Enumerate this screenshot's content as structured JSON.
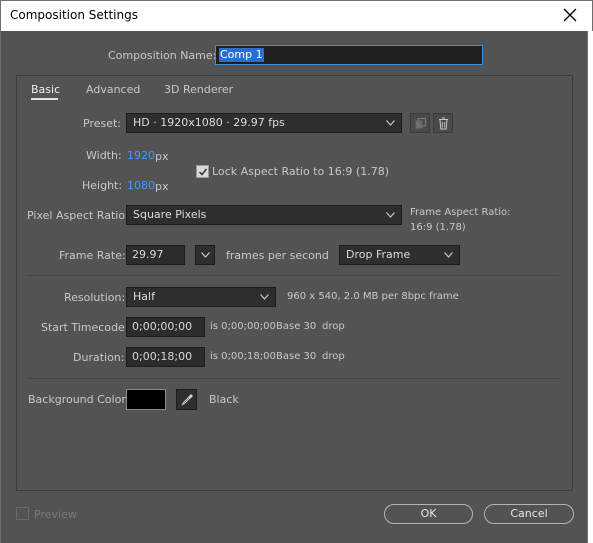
{
  "window": {
    "title": "Composition Settings"
  },
  "comp_name": {
    "label": "Composition Name:",
    "value": "Comp 1"
  },
  "tabs": [
    {
      "label": "Basic"
    },
    {
      "label": "Advanced"
    },
    {
      "label": "3D Renderer"
    }
  ],
  "preset": {
    "label": "Preset:",
    "value": "HD  ·  1920x1080 · 29.97 fps"
  },
  "width": {
    "label": "Width:",
    "value": "1920",
    "unit": "px"
  },
  "height": {
    "label": "Height:",
    "value": "1080",
    "unit": "px"
  },
  "lock_aspect": {
    "label": "Lock Aspect Ratio to 16:9 (1.78)",
    "checked": true
  },
  "pixel_aspect": {
    "label": "Pixel Aspect Ratio:",
    "value": "Square Pixels",
    "frame_aspect_label": "Frame Aspect Ratio:",
    "frame_aspect_value": "16:9 (1.78)"
  },
  "frame_rate": {
    "label": "Frame Rate:",
    "value": "29.97",
    "unit_label": "frames per second",
    "drop_value": "Drop Frame"
  },
  "resolution": {
    "label": "Resolution:",
    "value": "Half",
    "info": "960 x 540, 2.0 MB per 8bpc frame"
  },
  "start_timecode": {
    "label": "Start Timecode:",
    "value": "0;00;00;00",
    "is_text": "is 0;00;00;00",
    "base": "Base 30",
    "drop": "drop"
  },
  "duration": {
    "label": "Duration:",
    "value": "0;00;18;00",
    "is_text": "is 0;00;18;00",
    "base": "Base 30",
    "drop": "drop"
  },
  "background": {
    "label": "Background Color:",
    "color_name": "Black",
    "color": "#000000"
  },
  "footer": {
    "preview_label": "Preview",
    "ok_label": "OK",
    "cancel_label": "Cancel"
  }
}
